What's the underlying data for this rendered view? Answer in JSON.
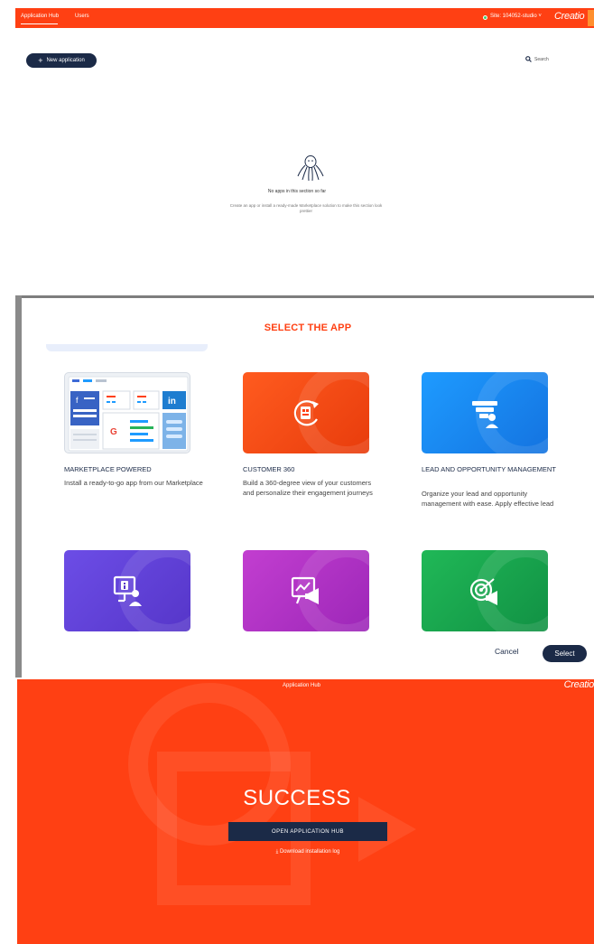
{
  "colors": {
    "brand": "#ff4013",
    "navy": "#1b2a47"
  },
  "hub": {
    "tabs": [
      "Application Hub",
      "Users"
    ],
    "site_label": "Site: 104052-studio",
    "site_caret": "˅",
    "logo": "Creatio",
    "new_app_label": "New application",
    "new_app_icon": "+",
    "search_icon": "search-icon",
    "search_label": "Search",
    "empty_icon": "octopus-icon",
    "empty_title": "No apps in this section so far",
    "empty_text": "Create an app or install a ready-made Marketplace solution to make this section look prettier"
  },
  "modal": {
    "title": "SELECT THE APP",
    "cards": [
      {
        "title": "MARKETPLACE POWERED",
        "desc": "Install a ready-to-go app from our Marketplace",
        "icon": "marketplace-collage"
      },
      {
        "title": "CUSTOMER 360",
        "desc": "Build a 360-degree view of your customers and personalize their engagement journeys",
        "icon": "customer-360-icon"
      },
      {
        "title": "LEAD AND OPPORTUNITY MANAGEMENT",
        "desc": "Organize your lead and opportunity management with ease. Apply effective lead",
        "icon": "lead-funnel-icon"
      },
      {
        "title": "",
        "desc": "",
        "icon": "presentation-info-icon"
      },
      {
        "title": "",
        "desc": "",
        "icon": "marketing-screen-icon"
      },
      {
        "title": "",
        "desc": "",
        "icon": "target-megaphone-icon"
      }
    ],
    "cancel_label": "Cancel",
    "select_label": "Select",
    "marketplace_badges": {
      "linkedin": "in",
      "facebook": "f",
      "google": "G"
    }
  },
  "success": {
    "header": "Application Hub",
    "logo": "Creatio",
    "title": "SUCCESS",
    "open_label": "OPEN APPLICATION HUB",
    "download_icon": "⤓",
    "download_label": "Download installation log"
  }
}
